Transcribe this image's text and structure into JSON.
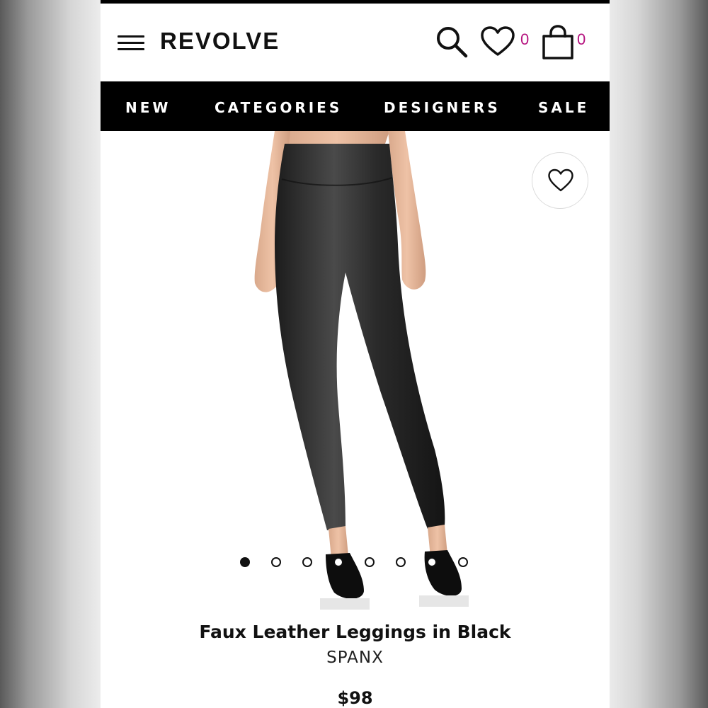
{
  "header": {
    "logo": "REVOLVE",
    "wishlist_count": "0",
    "bag_count": "0",
    "count_color": "#b5127f"
  },
  "icons": {
    "menu": "hamburger-menu-icon",
    "search": "search-icon",
    "wishlist": "heart-icon",
    "bag": "shopping-bag-icon",
    "favorite": "heart-icon"
  },
  "nav": {
    "items": [
      {
        "label": "NEW"
      },
      {
        "label": "CATEGORIES"
      },
      {
        "label": "DESIGNERS"
      },
      {
        "label": "SALE"
      }
    ]
  },
  "carousel": {
    "total_images": 8,
    "active_index": 0
  },
  "product": {
    "title": "Faux Leather Leggings in Black",
    "brand": "SPANX",
    "price": "$98"
  }
}
